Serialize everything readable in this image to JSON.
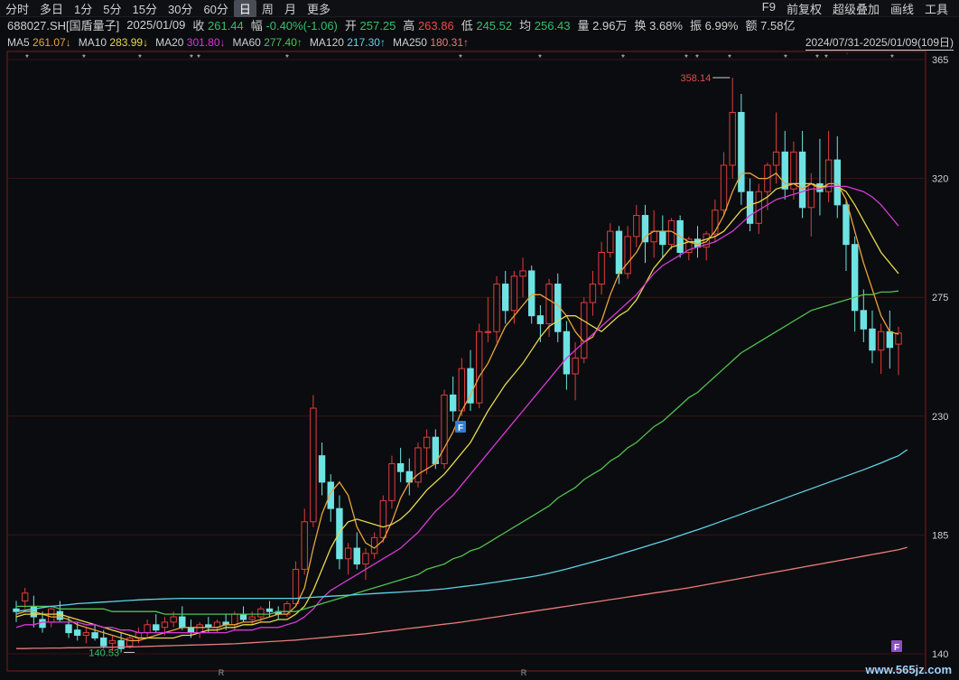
{
  "toolbar": {
    "periods": [
      "分时",
      "多日",
      "1分",
      "5分",
      "15分",
      "30分",
      "60分",
      "日",
      "周",
      "月",
      "更多"
    ],
    "active": "日",
    "right": [
      "F9",
      "前复权",
      "超级叠加",
      "画线",
      "工具"
    ]
  },
  "info": {
    "code": "688027.SH[国盾量子]",
    "date": "2025/01/09",
    "close_label": "收",
    "close": "261.44",
    "chg_label": "幅",
    "chg": "-0.40%(-1.06)",
    "open_label": "开",
    "open": "257.25",
    "high_label": "高",
    "high": "263.86",
    "low_label": "低",
    "low": "245.52",
    "avg_label": "均",
    "avg": "256.43",
    "vol_label": "量",
    "vol": "2.96万",
    "turn_label": "换",
    "turn": "3.68%",
    "amp_label": "振",
    "amp": "6.99%",
    "amt_label": "额",
    "amt": "7.58亿"
  },
  "ma_bar": {
    "items": [
      {
        "label": "MA5",
        "value": "261.07↓",
        "color": "#e8a43c"
      },
      {
        "label": "MA10",
        "value": "283.99↓",
        "color": "#e6d84a"
      },
      {
        "label": "MA20",
        "value": "301.80↓",
        "color": "#d63ad6"
      },
      {
        "label": "MA60",
        "value": "277.40↑",
        "color": "#4fc24f"
      },
      {
        "label": "MA120",
        "value": "217.30↑",
        "color": "#5fd3e6"
      },
      {
        "label": "MA250",
        "value": "180.31↑",
        "color": "#e97b7b"
      }
    ],
    "range": "2024/07/31-2025/01/09(109日)"
  },
  "chart_data": {
    "type": "candlestick",
    "ylim": [
      140,
      365
    ],
    "yticks": [
      365,
      320,
      275,
      230,
      185,
      140
    ],
    "max_label": "358.14",
    "min_label": "140.53",
    "marker_r": "R",
    "marker_f": "F",
    "candles": [
      [
        157,
        160,
        152,
        156
      ],
      [
        160,
        165,
        157,
        163
      ],
      [
        158,
        162,
        150,
        154
      ],
      [
        153,
        156,
        148,
        150
      ],
      [
        152,
        158,
        150,
        157
      ],
      [
        156,
        160,
        152,
        153
      ],
      [
        151,
        154,
        146,
        148
      ],
      [
        149,
        152,
        145,
        147
      ],
      [
        147,
        150,
        144,
        148
      ],
      [
        148,
        151,
        145,
        146
      ],
      [
        146,
        149,
        142,
        143
      ],
      [
        144,
        147,
        141,
        145
      ],
      [
        145,
        148,
        140.53,
        142
      ],
      [
        143,
        147,
        142,
        146
      ],
      [
        146,
        150,
        144,
        148
      ],
      [
        148,
        153,
        146,
        151
      ],
      [
        151,
        155,
        148,
        149
      ],
      [
        150,
        154,
        147,
        152
      ],
      [
        152,
        156,
        150,
        154
      ],
      [
        154,
        158,
        149,
        150
      ],
      [
        150,
        153,
        146,
        148
      ],
      [
        148,
        152,
        146,
        151
      ],
      [
        151,
        154,
        148,
        150
      ],
      [
        150,
        153,
        148,
        152
      ],
      [
        152,
        155,
        149,
        151
      ],
      [
        151,
        156,
        149,
        155
      ],
      [
        155,
        158,
        152,
        153
      ],
      [
        153,
        156,
        151,
        154
      ],
      [
        154,
        158,
        152,
        157
      ],
      [
        157,
        160,
        154,
        156
      ],
      [
        156,
        158,
        153,
        155
      ],
      [
        155,
        160,
        154,
        159
      ],
      [
        159,
        175,
        158,
        172
      ],
      [
        172,
        195,
        170,
        190
      ],
      [
        190,
        238,
        188,
        233
      ],
      [
        215,
        220,
        200,
        205
      ],
      [
        205,
        208,
        190,
        195
      ],
      [
        195,
        200,
        172,
        176
      ],
      [
        176,
        182,
        170,
        180
      ],
      [
        180,
        186,
        172,
        174
      ],
      [
        174,
        180,
        168,
        178
      ],
      [
        178,
        186,
        176,
        184
      ],
      [
        184,
        200,
        182,
        198
      ],
      [
        198,
        215,
        195,
        212
      ],
      [
        212,
        218,
        205,
        209
      ],
      [
        209,
        214,
        200,
        205
      ],
      [
        205,
        220,
        203,
        218
      ],
      [
        218,
        225,
        208,
        222
      ],
      [
        222,
        225,
        210,
        212
      ],
      [
        212,
        240,
        210,
        238
      ],
      [
        238,
        245,
        228,
        232
      ],
      [
        232,
        252,
        230,
        248
      ],
      [
        248,
        255,
        232,
        235
      ],
      [
        235,
        265,
        233,
        262
      ],
      [
        262,
        275,
        258,
        262
      ],
      [
        262,
        283,
        258,
        280
      ],
      [
        280,
        285,
        265,
        270
      ],
      [
        270,
        285,
        265,
        283
      ],
      [
        283,
        290,
        275,
        285
      ],
      [
        285,
        287,
        265,
        268
      ],
      [
        268,
        272,
        258,
        265
      ],
      [
        265,
        282,
        260,
        280
      ],
      [
        280,
        284,
        258,
        262
      ],
      [
        262,
        266,
        240,
        246
      ],
      [
        246,
        258,
        236,
        252
      ],
      [
        252,
        275,
        250,
        273
      ],
      [
        273,
        285,
        268,
        280
      ],
      [
        280,
        296,
        276,
        292
      ],
      [
        292,
        303,
        290,
        300
      ],
      [
        300,
        302,
        280,
        284
      ],
      [
        284,
        302,
        282,
        298
      ],
      [
        298,
        310,
        294,
        306
      ],
      [
        306,
        310,
        288,
        296
      ],
      [
        296,
        308,
        290,
        300
      ],
      [
        300,
        306,
        290,
        295
      ],
      [
        295,
        305,
        293,
        304
      ],
      [
        304,
        306,
        290,
        292
      ],
      [
        292,
        298,
        289,
        297
      ],
      [
        297,
        302,
        290,
        294
      ],
      [
        294,
        300,
        289,
        299
      ],
      [
        299,
        312,
        296,
        308
      ],
      [
        308,
        330,
        306,
        325
      ],
      [
        325,
        358.14,
        320,
        345
      ],
      [
        345,
        352,
        310,
        315
      ],
      [
        315,
        320,
        300,
        303
      ],
      [
        303,
        318,
        299,
        315
      ],
      [
        315,
        326,
        308,
        325
      ],
      [
        325,
        345,
        318,
        330
      ],
      [
        330,
        338,
        312,
        316
      ],
      [
        316,
        334,
        312,
        330
      ],
      [
        330,
        338,
        305,
        309
      ],
      [
        309,
        322,
        298,
        318
      ],
      [
        318,
        335,
        306,
        315
      ],
      [
        315,
        338,
        311,
        327
      ],
      [
        327,
        336,
        305,
        310
      ],
      [
        310,
        312,
        285,
        295
      ],
      [
        295,
        298,
        262,
        270
      ],
      [
        270,
        278,
        258,
        263
      ],
      [
        263,
        270,
        250,
        255
      ],
      [
        255,
        265,
        246,
        262
      ],
      [
        262,
        270,
        248,
        256
      ],
      [
        257.25,
        263.86,
        245.52,
        261.44
      ]
    ],
    "ma": [
      {
        "name": "MA5",
        "color": "#e8a43c",
        "values": [
          155,
          156,
          156,
          155,
          154,
          154,
          153,
          151,
          150,
          149,
          148,
          147,
          146,
          145,
          145,
          146,
          147,
          148,
          149,
          150,
          150,
          150,
          150,
          150,
          151,
          151,
          152,
          152,
          153,
          154,
          155,
          155,
          158,
          165,
          180,
          193,
          201,
          205,
          200,
          188,
          182,
          180,
          183,
          190,
          199,
          205,
          208,
          210,
          212,
          218,
          224,
          232,
          238,
          245,
          250,
          257,
          264,
          268,
          272,
          276,
          276,
          274,
          272,
          268,
          262,
          258,
          260,
          266,
          276,
          284,
          288,
          292,
          298,
          300,
          300,
          300,
          298,
          296,
          295,
          296,
          300,
          306,
          315,
          322,
          322,
          320,
          320,
          322,
          318,
          318,
          316,
          318,
          316,
          318,
          318,
          312,
          300,
          288,
          278,
          268,
          262,
          261
        ]
      },
      {
        "name": "MA10",
        "color": "#e6d84a",
        "values": [
          154,
          155,
          155,
          155,
          155,
          155,
          154,
          153,
          152,
          151,
          150,
          149,
          148,
          147,
          146,
          146,
          146,
          146,
          146,
          147,
          147,
          148,
          149,
          149,
          150,
          150,
          151,
          151,
          152,
          152,
          153,
          153,
          155,
          158,
          164,
          172,
          180,
          186,
          190,
          191,
          190,
          189,
          188,
          189,
          191,
          194,
          198,
          202,
          205,
          208,
          212,
          216,
          220,
          226,
          232,
          237,
          242,
          246,
          250,
          255,
          260,
          264,
          266,
          268,
          268,
          266,
          264,
          262,
          265,
          268,
          270,
          274,
          280,
          286,
          290,
          294,
          295,
          296,
          296,
          297,
          298,
          300,
          304,
          308,
          310,
          311,
          313,
          316,
          317,
          318,
          318,
          318,
          317,
          317,
          317,
          315,
          310,
          304,
          298,
          292,
          288,
          284
        ]
      },
      {
        "name": "MA20",
        "color": "#d63ad6",
        "values": [
          150,
          151,
          151,
          152,
          152,
          152,
          152,
          152,
          151,
          151,
          150,
          150,
          149,
          149,
          148,
          148,
          148,
          148,
          148,
          148,
          148,
          148,
          148,
          148,
          148,
          149,
          149,
          149,
          150,
          150,
          150,
          151,
          152,
          154,
          157,
          161,
          164,
          166,
          168,
          170,
          172,
          174,
          176,
          178,
          180,
          183,
          186,
          190,
          194,
          197,
          200,
          204,
          208,
          212,
          216,
          220,
          224,
          228,
          232,
          236,
          240,
          244,
          248,
          252,
          255,
          258,
          261,
          264,
          267,
          270,
          273,
          276,
          280,
          284,
          287,
          289,
          291,
          293,
          294,
          295,
          296,
          298,
          300,
          303,
          306,
          308,
          310,
          312,
          313,
          314,
          315,
          316,
          316,
          317,
          317,
          317,
          316,
          315,
          313,
          310,
          306,
          302
        ]
      },
      {
        "name": "MA60",
        "color": "#4fc24f",
        "values": [
          158,
          158,
          158,
          158,
          158,
          157,
          157,
          157,
          157,
          157,
          157,
          156,
          156,
          156,
          156,
          156,
          156,
          155,
          155,
          155,
          155,
          155,
          155,
          155,
          155,
          155,
          155,
          155,
          155,
          155,
          156,
          156,
          156,
          157,
          158,
          159,
          160,
          161,
          162,
          163,
          164,
          165,
          166,
          167,
          168,
          169,
          170,
          172,
          173,
          174,
          176,
          177,
          179,
          180,
          182,
          184,
          186,
          188,
          190,
          192,
          194,
          196,
          199,
          201,
          203,
          206,
          208,
          210,
          213,
          215,
          218,
          220,
          223,
          226,
          228,
          231,
          234,
          237,
          239,
          242,
          245,
          248,
          251,
          254,
          256,
          258,
          260,
          262,
          264,
          266,
          268,
          270,
          271,
          272,
          273,
          274,
          275,
          276,
          276,
          277,
          277,
          277.4
        ]
      },
      {
        "name": "MA120",
        "color": "#5fd3e6",
        "values": [
          156,
          156.5,
          157,
          157.5,
          158,
          158.3,
          158.6,
          159,
          159.2,
          159.4,
          159.6,
          159.8,
          160,
          160.2,
          160.4,
          160.6,
          160.7,
          160.8,
          160.9,
          161,
          161,
          161,
          161,
          161,
          161,
          161,
          161,
          161,
          161,
          161,
          161,
          161,
          161,
          161.2,
          161.4,
          161.6,
          161.8,
          162,
          162.2,
          162.4,
          162.6,
          162.8,
          163,
          163.2,
          163.4,
          163.6,
          163.8,
          164,
          164.3,
          164.6,
          165,
          165.4,
          165.8,
          166.2,
          166.7,
          167.2,
          167.7,
          168.2,
          168.7,
          169.2,
          169.8,
          170.5,
          171.3,
          172.1,
          173,
          173.9,
          174.8,
          175.7,
          176.6,
          177.6,
          178.6,
          179.6,
          180.6,
          181.6,
          182.6,
          183.7,
          184.8,
          185.9,
          187,
          188.1,
          189.3,
          190.5,
          191.7,
          192.9,
          194.1,
          195.3,
          196.5,
          197.7,
          198.9,
          200.1,
          201.3,
          202.5,
          203.7,
          204.9,
          206.1,
          207.3,
          208.5,
          209.7,
          211,
          212.3,
          213.7,
          215,
          217.3
        ]
      },
      {
        "name": "MA250",
        "color": "#e97b7b",
        "values": [
          142,
          142,
          142.1,
          142.1,
          142.2,
          142.2,
          142.3,
          142.3,
          142.4,
          142.4,
          142.5,
          142.5,
          142.6,
          142.6,
          142.7,
          142.8,
          142.9,
          143,
          143.1,
          143.2,
          143.3,
          143.4,
          143.5,
          143.6,
          143.7,
          143.8,
          144,
          144.2,
          144.4,
          144.6,
          144.8,
          145,
          145.2,
          145.5,
          145.8,
          146.1,
          146.4,
          146.7,
          147,
          147.3,
          147.6,
          148,
          148.4,
          148.8,
          149.2,
          149.6,
          150,
          150.4,
          150.8,
          151.2,
          151.6,
          152,
          152.5,
          153,
          153.5,
          154,
          154.5,
          155,
          155.5,
          156,
          156.5,
          157,
          157.5,
          158,
          158.5,
          159,
          159.5,
          160,
          160.5,
          161,
          161.5,
          162,
          162.5,
          163,
          163.5,
          164,
          164.5,
          165,
          165.6,
          166.2,
          166.8,
          167.4,
          168,
          168.6,
          169.2,
          169.8,
          170.4,
          171,
          171.6,
          172.2,
          172.8,
          173.4,
          174,
          174.6,
          175.2,
          175.8,
          176.4,
          177,
          177.6,
          178.2,
          178.8,
          179.4,
          180.31
        ]
      }
    ]
  },
  "watermark": "www.565jz.com"
}
